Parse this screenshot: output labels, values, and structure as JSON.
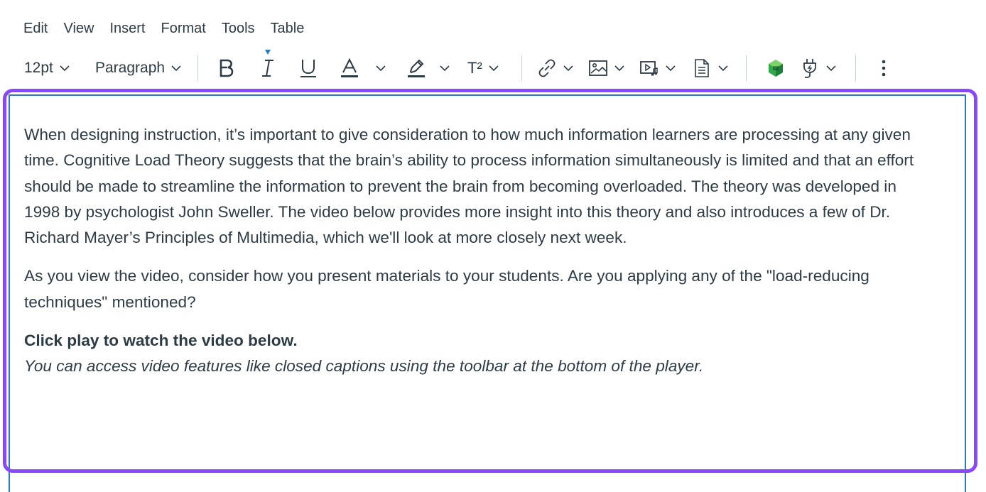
{
  "menubar": {
    "items": [
      {
        "label": "Edit"
      },
      {
        "label": "View"
      },
      {
        "label": "Insert"
      },
      {
        "label": "Format"
      },
      {
        "label": "Tools"
      },
      {
        "label": "Table"
      }
    ]
  },
  "toolbar": {
    "font_size": "12pt",
    "block_format": "Paragraph",
    "superscript_glyph": "T²",
    "icons": [
      "bold-icon",
      "italic-icon",
      "underline-icon",
      "text-color-icon",
      "highlight-icon",
      "superscript-icon",
      "link-icon",
      "image-icon",
      "media-icon",
      "document-icon",
      "apps-icon",
      "plugin-icon",
      "more-icon"
    ]
  },
  "colors": {
    "accent_frame": "#8b46ff",
    "editor_border": "#2b7abc",
    "text": "#2d3b45",
    "app_icon_green": "#2eaa4a"
  },
  "content": {
    "paragraph1": "When designing instruction, it’s important to give consideration to how much information learners are processing at any given time. Cognitive Load Theory suggests that the brain’s ability to process information simultaneously is limited and that an effort should be made to streamline the information to prevent the brain from becoming overloaded. The theory was developed in 1998 by psychologist John Sweller. The video below provides more insight into this theory and also introduces a few of Dr. Richard Mayer’s Principles of Multimedia, which we'll look at more closely next week.",
    "paragraph2": "As you view the video, consider how you present materials to your students. Are you applying any of the \"load-reducing techniques\" mentioned?",
    "bold_line": "Click play to watch the video below.",
    "italic_line": "You can access video features like closed captions using the toolbar at the bottom of the player."
  }
}
